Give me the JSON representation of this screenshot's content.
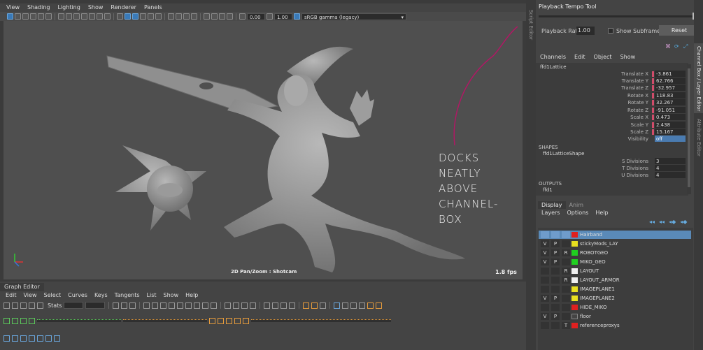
{
  "viewport": {
    "menu": [
      "View",
      "Shading",
      "Lighting",
      "Show",
      "Renderer",
      "Panels"
    ],
    "toolbar": {
      "exposure": "0.00",
      "gamma": "1.00",
      "colorspace": "sRGB gamma (legacy)"
    },
    "camera_label": "2D Pan/Zoom : Shotcam",
    "fps": "1.8 fps"
  },
  "annotation": {
    "line1": "DOCKS NEATLY",
    "line2": "ABOVE CHANNEL-",
    "line3": "BOX"
  },
  "playback": {
    "title": "Playback Tempo Tool",
    "rate_label": "Playback Rate:",
    "rate_value": "1.00",
    "subframes_label": "Show Subframes",
    "reset_label": "Reset"
  },
  "script_editor_tab": "Script Editor",
  "side_tabs": {
    "channel_box": "Channel Box / Layer Editor",
    "attribute_editor": "Attribute Editor"
  },
  "channel_box": {
    "menu": [
      "Channels",
      "Edit",
      "Object",
      "Show"
    ],
    "object": "ffd1Lattice",
    "channels": [
      {
        "label": "Translate X",
        "value": "-3.861"
      },
      {
        "label": "Translate Y",
        "value": "62.766"
      },
      {
        "label": "Translate Z",
        "value": "-32.957"
      },
      {
        "label": "Rotate X",
        "value": "118.83"
      },
      {
        "label": "Rotate Y",
        "value": "32.267"
      },
      {
        "label": "Rotate Z",
        "value": "-91.051"
      },
      {
        "label": "Scale X",
        "value": "0.473"
      },
      {
        "label": "Scale Y",
        "value": "2.438"
      },
      {
        "label": "Scale Z",
        "value": "15.167"
      },
      {
        "label": "Visibility",
        "value": "off"
      }
    ],
    "shapes_header": "SHAPES",
    "shape_name": "ffd1LatticeShape",
    "shape_channels": [
      {
        "label": "S Divisions",
        "value": "3"
      },
      {
        "label": "T Divisions",
        "value": "4"
      },
      {
        "label": "U Divisions",
        "value": "4"
      }
    ],
    "outputs_header": "OUTPUTS",
    "output_name": "ffd1"
  },
  "layer_editor": {
    "tabs": [
      "Display",
      "Anim"
    ],
    "menu": [
      "Layers",
      "Options",
      "Help"
    ],
    "layers": [
      {
        "v": "",
        "p": "",
        "r": "",
        "color": "#e02020",
        "name": "Hairband",
        "selected": true
      },
      {
        "v": "V",
        "p": "P",
        "r": "",
        "color": "#e8e020",
        "name": "stickyMods_LAY"
      },
      {
        "v": "V",
        "p": "P",
        "r": "R",
        "color": "#20d020",
        "name": "ROBOTGEO"
      },
      {
        "v": "V",
        "p": "P",
        "r": "",
        "color": "#20d020",
        "name": "MIKO_GEO"
      },
      {
        "v": "",
        "p": "",
        "r": "R",
        "color": "#f0f0f0",
        "name": "LAYOUT"
      },
      {
        "v": "",
        "p": "",
        "r": "R",
        "color": "#f0f0f0",
        "name": "LAYOUT_ARMOR"
      },
      {
        "v": "",
        "p": "",
        "r": "",
        "color": "#e8e020",
        "name": "IMAGEPLANE1"
      },
      {
        "v": "V",
        "p": "P",
        "r": "",
        "color": "#e8e020",
        "name": "IMAGEPLANE2"
      },
      {
        "v": "",
        "p": "",
        "r": "",
        "color": "#e02020",
        "name": "HIDE_MIKO"
      },
      {
        "v": "V",
        "p": "P",
        "r": "",
        "color": "#444444",
        "name": "floor"
      },
      {
        "v": "",
        "p": "",
        "r": "T",
        "color": "#e02020",
        "name": "referenceproxys"
      }
    ]
  },
  "graph_editor": {
    "title": "Graph Editor",
    "menu": [
      "Edit",
      "View",
      "Select",
      "Curves",
      "Keys",
      "Tangents",
      "List",
      "Show",
      "Help"
    ],
    "stats_label": "Stats"
  }
}
